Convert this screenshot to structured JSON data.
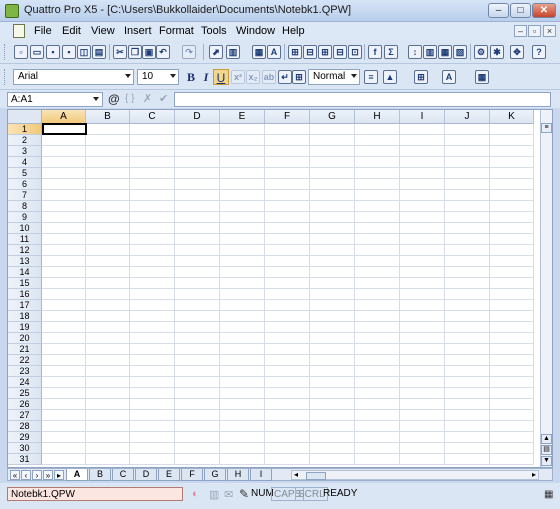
{
  "window": {
    "title": "Quattro Pro X5 - [C:\\Users\\Bukkollaider\\Documents\\Notebk1.QPW]",
    "min_label": "–",
    "max_label": "□",
    "close_label": "✕"
  },
  "menubar": {
    "items": [
      "File",
      "Edit",
      "View",
      "Insert",
      "Format",
      "Tools",
      "Window",
      "Help"
    ]
  },
  "property_bar": {
    "font": "Arial",
    "size": "10",
    "style": "Normal",
    "bold_label": "B",
    "italic_label": "I",
    "underline_label": "U"
  },
  "input_line": {
    "cell_reference": "A:A1",
    "at_label": "@",
    "braces_label": "{ }",
    "cancel_label": "✗",
    "accept_label": "✔",
    "formula": ""
  },
  "columns": [
    "A",
    "B",
    "C",
    "D",
    "E",
    "F",
    "G",
    "H",
    "I",
    "J",
    "K"
  ],
  "rows": [
    "1",
    "2",
    "3",
    "4",
    "5",
    "6",
    "7",
    "8",
    "9",
    "10",
    "11",
    "12",
    "13",
    "14",
    "15",
    "16",
    "17",
    "18",
    "19",
    "20",
    "21",
    "22",
    "23",
    "24",
    "25",
    "26",
    "27",
    "28",
    "29",
    "30",
    "31"
  ],
  "active_cell": "A1",
  "sheet_tabs": [
    "A",
    "B",
    "C",
    "D",
    "E",
    "F",
    "G",
    "H",
    "I"
  ],
  "active_sheet": "A",
  "status": {
    "notebook": "Notebk1.QPW",
    "num": "NUM",
    "caps": "CAPS",
    "scrl": "SCRL",
    "mode": "READY"
  }
}
